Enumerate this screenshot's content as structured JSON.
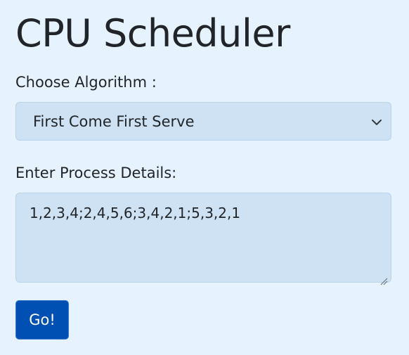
{
  "header": {
    "title": "CPU Scheduler"
  },
  "algorithm": {
    "label": "Choose Algorithm :",
    "selected": "First Come First Serve"
  },
  "process": {
    "label": "Enter Process Details:",
    "value": "1,2,3,4;2,4,5,6;3,4,2,1;5,3,2,1"
  },
  "actions": {
    "go_label": "Go!"
  },
  "colors": {
    "background": "#e6f3ff",
    "field": "#cfe2f3",
    "button": "#0050b3"
  },
  "icons": {
    "select_arrow": "chevron-down-icon",
    "resize": "resize-handle-icon"
  }
}
